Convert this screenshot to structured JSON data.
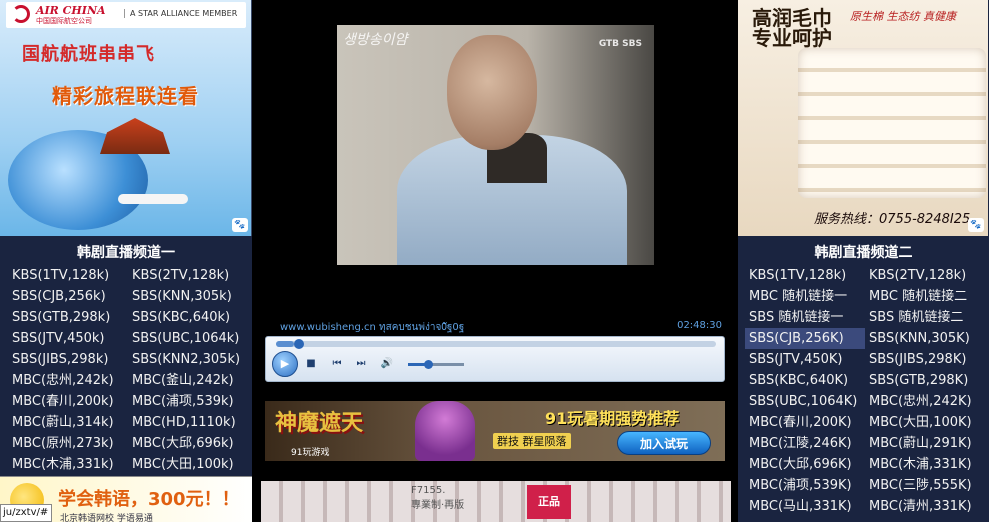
{
  "left_ad": {
    "brand": "AIR CHINA",
    "brand_cn": "中国国际航空公司",
    "alliance": "A STAR ALLIANCE MEMBER",
    "line1": "国航航班串串飞",
    "line2": "精彩旅程联连看"
  },
  "left_panel": {
    "title": "韩剧直播频道一",
    "channels": [
      "KBS(1TV,128k)",
      "KBS(2TV,128k)",
      "SBS(CJB,256k)",
      "SBS(KNN,305k)",
      "SBS(GTB,298k)",
      "SBS(KBC,640k)",
      "SBS(JTV,450k)",
      "SBS(UBC,1064k)",
      "SBS(JIBS,298k)",
      "SBS(KNN2,305k)",
      "MBC(忠州,242k)",
      "MBC(釜山,242k)",
      "MBC(春川,200k)",
      "MBC(浦项,539k)",
      "MBC(蔚山,314k)",
      "MBC(HD,1110k)",
      "MBC(原州,273k)",
      "MBC(大邱,696k)",
      "MBC(木浦,331k)",
      "MBC(大田,100k)"
    ]
  },
  "left_bottom_ad": {
    "text": "学会韩语，300元！！",
    "sub": "北京韩语网校 学语易通"
  },
  "status_url": "ju/zxtv/#",
  "video": {
    "logo_left": "생방송이얌",
    "logo_right": "GTB SBS",
    "url": "www.wubisheng.cn ทุสคบชนพ่ง่าจ0ัฐ0ฐ",
    "time": "02:48:30",
    "progress": 0.04,
    "volume": 0.35
  },
  "game_ad": {
    "logo": "神魔遮天",
    "title": "91玩暑期强势推荐",
    "sub": "群技 群星陨落",
    "button": "加入试玩",
    "brand": "91玩游戏"
  },
  "bottom_ad": {
    "tag": "F7155.",
    "tag_sub": "專業制·再版",
    "badge": "正品"
  },
  "right_ad": {
    "title1": "高润毛巾",
    "title2": "专业呵护",
    "slogan": "原生棉 生态纺 真健康",
    "phone": "服务热线：0755-8248I25"
  },
  "right_panel": {
    "title": "韩剧直播频道二",
    "active_index": 6,
    "channels": [
      "KBS(1TV,128k)",
      "KBS(2TV,128k)",
      "MBC 随机链接一",
      "MBC 随机链接二",
      "SBS 随机链接一",
      "SBS 随机链接二",
      "SBS(CJB,256K)",
      "SBS(KNN,305K)",
      "SBS(JTV,450K)",
      "SBS(JIBS,298K)",
      "SBS(KBC,640K)",
      "SBS(GTB,298K)",
      "SBS(UBC,1064K)",
      "MBC(忠州,242K)",
      "MBC(春川,200K)",
      "MBC(大田,100K)",
      "MBC(江陵,246K)",
      "MBC(蔚山,291K)",
      "MBC(大邱,696K)",
      "MBC(木浦,331K)",
      "MBC(浦项,539K)",
      "MBC(三陟,555K)",
      "MBC(马山,331K)",
      "MBC(清州,331K)"
    ]
  }
}
